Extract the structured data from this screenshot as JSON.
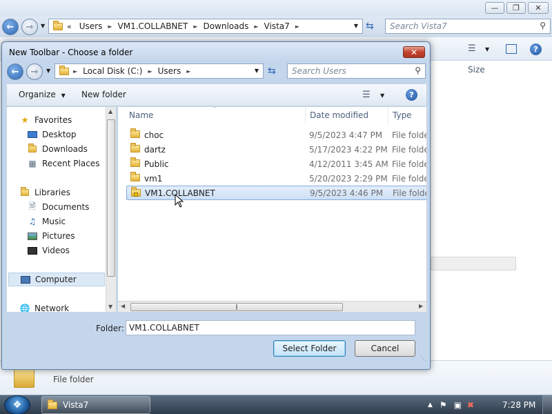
{
  "background_window": {
    "address_crumbs": [
      "Users",
      "VM1.COLLABNET",
      "Downloads",
      "Vista7"
    ],
    "search_placeholder": "Search Vista7",
    "size_column": "Size",
    "details_type": "File folder"
  },
  "dialog": {
    "title": "New Toolbar - Choose a folder",
    "close_glyph": "✕",
    "address_crumbs": [
      "Local Disk (C:)",
      "Users"
    ],
    "search_placeholder": "Search Users",
    "toolbar": {
      "organize_label": "Organize",
      "new_folder_label": "New folder"
    },
    "nav": {
      "favorites": "Favorites",
      "desktop": "Desktop",
      "downloads": "Downloads",
      "recent_places": "Recent Places",
      "libraries": "Libraries",
      "documents": "Documents",
      "music": "Music",
      "pictures": "Pictures",
      "videos": "Videos",
      "computer": "Computer",
      "network": "Network"
    },
    "columns": {
      "name": "Name",
      "date_modified": "Date modified",
      "type": "Type"
    },
    "files": [
      {
        "name": "choc",
        "date": "9/5/2023 4:47 PM",
        "type": "File folder"
      },
      {
        "name": "dartz",
        "date": "5/17/2023 4:22 PM",
        "type": "File folder"
      },
      {
        "name": "Public",
        "date": "4/12/2011 3:45 AM",
        "type": "File folder"
      },
      {
        "name": "vm1",
        "date": "5/20/2023 2:29 PM",
        "type": "File folder"
      },
      {
        "name": "VM1.COLLABNET",
        "date": "9/5/2023 4:46 PM",
        "type": "File folder"
      }
    ],
    "folder_label": "Folder:",
    "folder_value": "VM1.COLLABNET",
    "select_folder_label": "Select Folder",
    "cancel_label": "Cancel"
  },
  "taskbar": {
    "task_label": "Vista7",
    "clock": "7:28 PM"
  },
  "colors": {
    "selection": "#cde0f6",
    "dialog_frame": "#c4d6ec",
    "close_button": "#c0432e",
    "taskbar": "#2e3b4a"
  }
}
